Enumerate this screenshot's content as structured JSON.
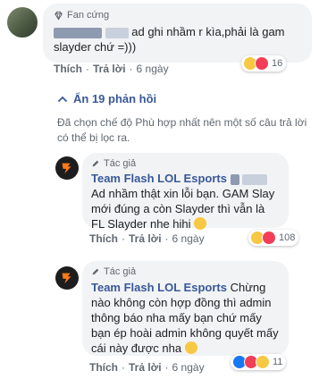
{
  "comment1": {
    "badge": "Fan cứng",
    "text": "ad ghi nhầm r kìa,phải là gam slayder chứ =)))",
    "actions": {
      "like": "Thích",
      "reply": "Trả lời",
      "time": "6 ngày"
    },
    "reaction_count": "16"
  },
  "replies_toggle": "Ẩn 19 phản hồi",
  "filter_note": "Đã chọn chế độ Phù hợp nhất nên một số câu trả lời có thể bị lọc ra.",
  "reply1": {
    "badge": "Tác giả",
    "author": "Team Flash LOL Esports",
    "text": "Ad nhầm thật xin lỗi bạn. GAM Slay mới đúng a còn Slayder thì vẫn là FL Slayder nhe hihi",
    "actions": {
      "like": "Thích",
      "reply": "Trả lời",
      "time": "6 ngày"
    },
    "reaction_count": "108"
  },
  "reply2": {
    "badge": "Tác giả",
    "author": "Team Flash LOL Esports",
    "text": "Chừng nào không còn hợp đồng thì admin thông báo nha mấy bạn chứ mấy bạn ép hoài admin không quyết mấy cái này được nha",
    "actions": {
      "like": "Thích",
      "reply": "Trả lời",
      "time": "6 ngày"
    },
    "reaction_count": "11"
  },
  "colors": {
    "link": "#385898",
    "bubble": "#f2f3f5",
    "muted": "#606770",
    "haha": "#f7c843",
    "love": "#f33e58",
    "like": "#1877f2"
  },
  "icons": [
    "diamond-badge-icon",
    "pen-badge-icon",
    "chevron-up-icon",
    "haha-reaction-icon",
    "love-reaction-icon",
    "like-reaction-icon",
    "team-flash-logo-icon"
  ]
}
